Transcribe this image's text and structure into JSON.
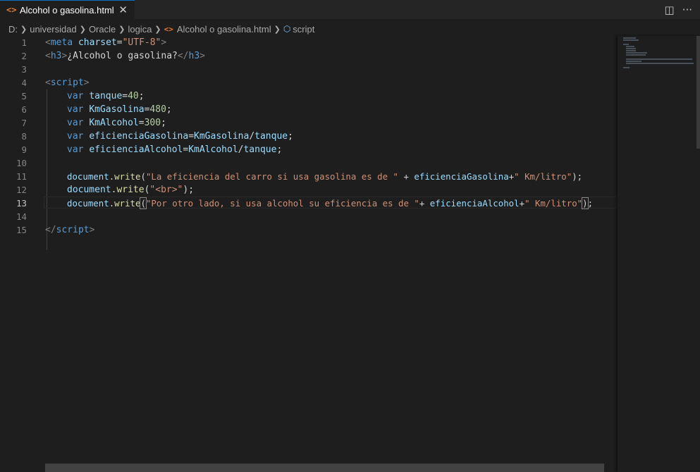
{
  "tab": {
    "icon": "html-file-icon",
    "label": "Alcohol o gasolina.html",
    "close_glyph": "✕"
  },
  "breadcrumb": {
    "drive": "D:",
    "folders": [
      "universidad",
      "Oracle",
      "logica"
    ],
    "file": "Alcohol o gasolina.html",
    "symbol": "script"
  },
  "editor": {
    "active_line": 13,
    "lines": [
      {
        "n": "1"
      },
      {
        "n": "2"
      },
      {
        "n": "3"
      },
      {
        "n": "4"
      },
      {
        "n": "5"
      },
      {
        "n": "6"
      },
      {
        "n": "7"
      },
      {
        "n": "8"
      },
      {
        "n": "9"
      },
      {
        "n": "10"
      },
      {
        "n": "11"
      },
      {
        "n": "12"
      },
      {
        "n": "13"
      },
      {
        "n": "14"
      },
      {
        "n": "15"
      }
    ],
    "code": {
      "l1": [
        "<",
        "meta",
        " ",
        "charset",
        "=",
        "\"UTF-8\"",
        ">"
      ],
      "l2": [
        "<",
        "h3",
        ">",
        "¿Alcohol o gasolina?",
        "</",
        "h3",
        ">"
      ],
      "l4": [
        "<",
        "script",
        ">"
      ],
      "l5": [
        "var",
        " ",
        "tanque",
        "=",
        "40",
        ";"
      ],
      "l6": [
        "var",
        " ",
        "KmGasolina",
        "=",
        "480",
        ";"
      ],
      "l7": [
        "var",
        " ",
        "KmAlcohol",
        "=",
        "300",
        ";"
      ],
      "l8": [
        "var",
        " ",
        "eficienciaGasolina",
        "=",
        "KmGasolina",
        "/",
        "tanque",
        ";"
      ],
      "l9": [
        "var",
        " ",
        "eficienciaAlcohol",
        "=",
        "KmAlcohol",
        "/",
        "tanque",
        ";"
      ],
      "l11": [
        "document",
        ".",
        "write",
        "(",
        "\"La eficiencia del carro si usa gasolina es de \"",
        " + ",
        "eficienciaGasolina",
        "+",
        "\" Km/litro\"",
        ");"
      ],
      "l12": [
        "document",
        ".",
        "write",
        "(",
        "\"<br>\"",
        ");"
      ],
      "l13": [
        "document",
        ".",
        "write",
        "(",
        "\"Por otro lado, si usa alcohol su eficiencia es de \"",
        "+ ",
        "eficienciaAlcohol",
        "+",
        "\" Km/litro\"",
        ")",
        ";"
      ],
      "l15": [
        "</",
        "script",
        ">"
      ]
    }
  },
  "toolbar": {
    "split_icon": "split-editor-icon",
    "more_icon": "more-actions-icon"
  }
}
